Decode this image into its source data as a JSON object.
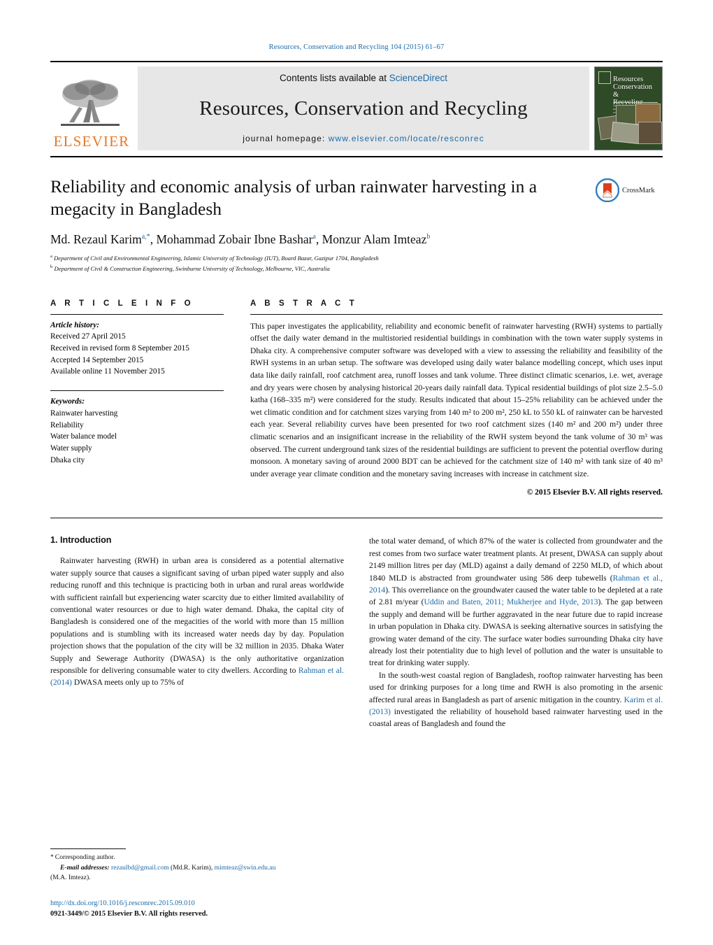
{
  "running_head": "Resources, Conservation and Recycling 104 (2015) 61–67",
  "masthead": {
    "contents_prefix": "Contents lists available at ",
    "contents_link": "ScienceDirect",
    "journal_title": "Resources, Conservation and Recycling",
    "homepage_prefix": "journal homepage:",
    "homepage_url": "www.elsevier.com/locate/resconrec",
    "publisher_wordmark": "ELSEVIER",
    "publisher_logo_icon": "elsevier-tree-logo",
    "cover_title_lines": [
      "Resources",
      "Conservation &",
      "Recycling"
    ],
    "cover_subtitle": "An International Journal of Sustainable Resource Management and Environmental Practice",
    "accent_link_color": "#1a6aa8",
    "elsevier_orange": "#E87722"
  },
  "article": {
    "title": "Reliability and economic analysis of urban rainwater harvesting in a megacity in Bangladesh",
    "authors_html": "Md. Rezaul Karim<sup>a,*</sup>, Mohammad Zobair Ibne Bashar<sup>a</sup>, Monzur Alam Imteaz<sup>b</sup>",
    "affiliations": [
      "Department of Civil and Environmental Engineering, Islamic University of Technology (IUT), Board Bazar, Gazipur 1704, Bangladesh",
      "Department of Civil & Construction Engineering, Swinburne University of Technology, Melbourne, VIC, Australia"
    ],
    "crossmark_label": "CrossMark",
    "crossmark_icon": "crossmark-logo"
  },
  "article_info": {
    "heading": "A R T I C L E   I N F O",
    "history_label": "Article history:",
    "history": [
      "Received 27 April 2015",
      "Received in revised form 8 September 2015",
      "Accepted 14 September 2015",
      "Available online 11 November 2015"
    ],
    "keywords_label": "Keywords:",
    "keywords": [
      "Rainwater harvesting",
      "Reliability",
      "Water balance model",
      "Water supply",
      "Dhaka city"
    ]
  },
  "abstract": {
    "heading": "A B S T R A C T",
    "text": "This paper investigates the applicability, reliability and economic benefit of rainwater harvesting (RWH) systems to partially offset the daily water demand in the multistoried residential buildings in combination with the town water supply systems in Dhaka city. A comprehensive computer software was developed with a view to assessing the reliability and feasibility of the RWH systems in an urban setup. The software was developed using daily water balance modelling concept, which uses input data like daily rainfall, roof catchment area, runoff losses and tank volume. Three distinct climatic scenarios, i.e. wet, average and dry years were chosen by analysing historical 20-years daily rainfall data. Typical residential buildings of plot size 2.5–5.0 katha (168–335 m²) were considered for the study. Results indicated that about 15–25% reliability can be achieved under the wet climatic condition and for catchment sizes varying from 140 m² to 200 m², 250 kL to 550 kL of rainwater can be harvested each year. Several reliability curves have been presented for two roof catchment sizes (140 m² and 200 m²) under three climatic scenarios and an insignificant increase in the reliability of the RWH system beyond the tank volume of 30 m³ was observed. The current underground tank sizes of the residential buildings are sufficient to prevent the potential overflow during monsoon. A monetary saving of around 2000 BDT can be achieved for the catchment size of 140 m² with tank size of 40 m³ under average year climate condition and the monetary saving increases with increase in catchment size.",
    "copyright": "© 2015 Elsevier B.V. All rights reserved."
  },
  "body": {
    "section_number_title": "1.  Introduction",
    "left_paragraph_1_a": "Rainwater harvesting (RWH) in urban area is considered as a potential alternative water supply source that causes a significant saving of urban piped water supply and also reducing runoff and this technique is practicing both in urban and rural areas worldwide with sufficient rainfall but experiencing water scarcity due to either limited availability of conventional water resources or due to high water demand. Dhaka, the capital city of Bangladesh is considered one of the megacities of the world with more than 15 million populations and is stumbling with its increased water needs day by day. Population projection shows that the population of the city will be 32 million in 2035. Dhaka Water Supply and Sewerage Authority (DWASA) is the only authoritative organization responsible for delivering consumable water to city dwellers. According to ",
    "left_ref_1": "Rahman et al. (2014)",
    "left_paragraph_1_b": " DWASA meets only up to 75% of",
    "right_paragraph_1_a": "the total water demand, of which 87% of the water is collected from groundwater and the rest comes from two surface water treatment plants. At present, DWASA can supply about 2149 million litres per day (MLD) against a daily demand of 2250 MLD, of which about 1840 MLD is abstracted from groundwater using 586 deep tubewells (",
    "right_ref_1": "Rahman et al., 2014",
    "right_paragraph_1_b": "). This overreliance on the groundwater caused the water table to be depleted at a rate of 2.81 m/year (",
    "right_ref_2": "Uddin and Baten, 2011; Mukherjee and Hyde, 2013",
    "right_paragraph_1_c": "). The gap between the supply and demand will be further aggravated in the near future due to rapid increase in urban population in Dhaka city. DWASA is seeking alternative sources in satisfying the growing water demand of the city. The surface water bodies surrounding Dhaka city have already lost their potentiality due to high level of pollution and the water is unsuitable to treat for drinking water supply.",
    "right_paragraph_2_a": "In the south-west coastal region of Bangladesh, rooftop rainwater harvesting has been used for drinking purposes for a long time and RWH is also promoting in the arsenic affected rural areas in Bangladesh as part of arsenic mitigation in the country. ",
    "right_ref_3": "Karim et al. (2013)",
    "right_paragraph_2_b": " investigated the reliability of household based rainwater harvesting used in the coastal areas of Bangladesh and found the"
  },
  "footer": {
    "corresponding_author": "Corresponding author.",
    "email_label": "E-mail addresses:",
    "email_1": "rezaulbd@gmail.com",
    "email_1_owner": " (Md.R. Karim), ",
    "email_2": "mimteaz@swin.edu.au",
    "email_2_owner": "(M.A. Imteaz).",
    "doi": "http://dx.doi.org/10.1016/j.resconrec.2015.09.010",
    "issn_line": "0921-3449/© 2015 Elsevier B.V. All rights reserved."
  }
}
